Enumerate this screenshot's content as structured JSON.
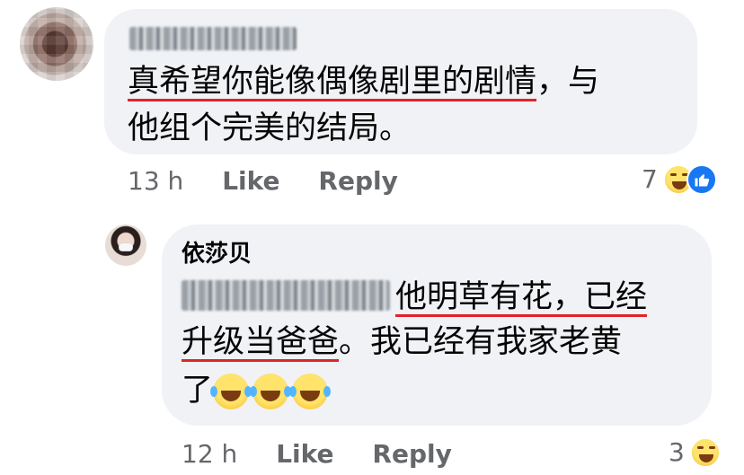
{
  "comment_1": {
    "author": "Lisa Maggie",
    "text_line_1": "真希望你能像偶像剧里的剧情，与",
    "text_line_1_underlined": "真希望你能像偶像剧里的剧情",
    "text_line_1_rest": "，与",
    "text_line_2": "他组个完美的结局。",
    "time": "13 h",
    "like_label": "Like",
    "reply_label": "Reply",
    "reaction_count": "7",
    "reactions": [
      "haha-icon",
      "like-icon"
    ]
  },
  "comment_2": {
    "author": "依莎贝",
    "mention": "Lisa Maggie",
    "text_line_1_underlined": "他明草有花，已经",
    "text_line_2_underlined": "升级当爸爸",
    "text_line_2_rest": "。我已经有我家老黄",
    "text_line_3": "了",
    "emoji": [
      "tears-of-joy-emoji",
      "tears-of-joy-emoji",
      "tears-of-joy-emoji"
    ],
    "time": "12 h",
    "like_label": "Like",
    "reply_label": "Reply",
    "reaction_count": "3",
    "reactions": [
      "haha-icon"
    ]
  },
  "colors": {
    "bubble": "#f0f2f5",
    "meta_text": "#65676b",
    "underline": "#e0242a",
    "like_blue": "#1877f2"
  }
}
